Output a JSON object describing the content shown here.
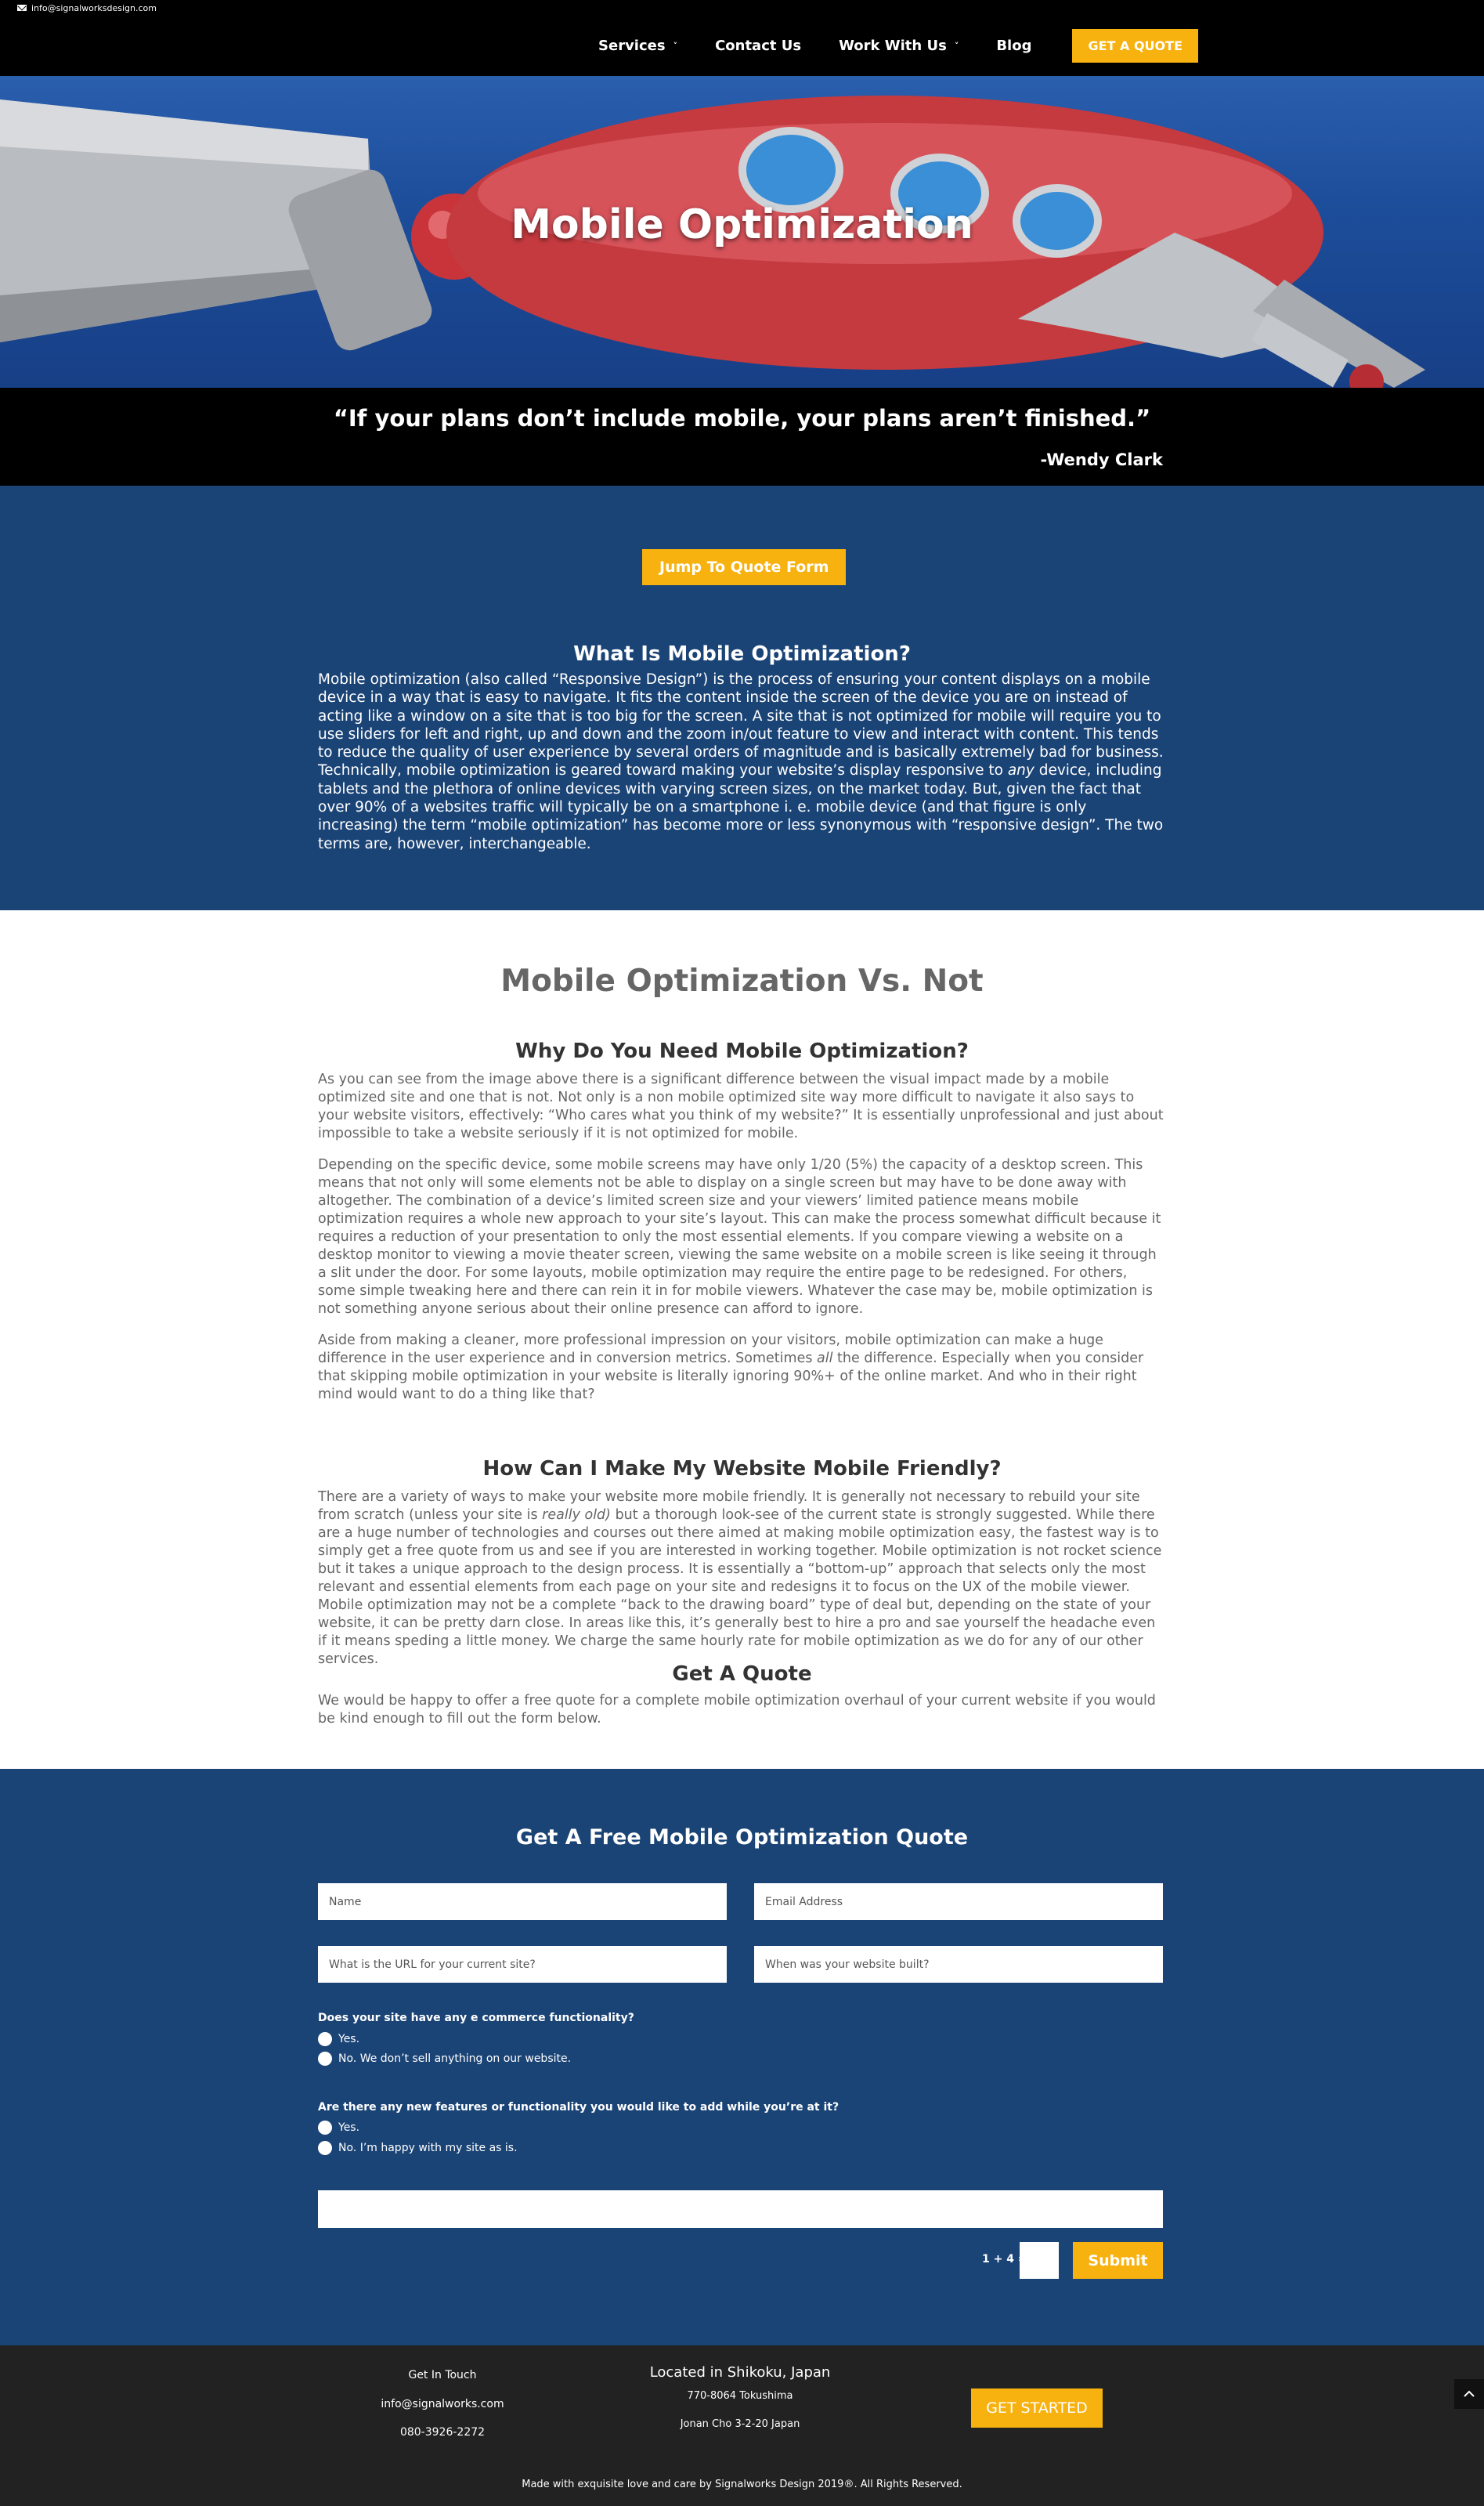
{
  "topbar": {
    "email": "info@signalworksdesign.com"
  },
  "nav": {
    "items": [
      {
        "label": "Services",
        "has_dropdown": true
      },
      {
        "label": "Contact Us",
        "has_dropdown": false
      },
      {
        "label": "Work With Us",
        "has_dropdown": true
      },
      {
        "label": "Blog",
        "has_dropdown": false
      }
    ],
    "cta": "GET A QUOTE"
  },
  "hero": {
    "title": "Mobile Optimization"
  },
  "quote": {
    "text": "“If your plans don’t include mobile, your plans aren’t finished.”",
    "author": "-Wendy Clark"
  },
  "intro": {
    "jump_button": "Jump To Quote Form",
    "title": "What Is Mobile Optimization?",
    "body_before_em": "Mobile optimization (also called “Responsive Design”)  is the process of ensuring your content displays on a  mobile device in a way that is easy to navigate. It fits the content inside the screen of the device you are on instead of acting like a window on a site that is too big for the screen. A site that is not optimized for mobile will require you to use sliders for left and right, up and down and  the zoom in/out feature to view and interact with content. This tends to reduce the quality of user experience by several orders of magnitude and is basically extremely bad for business. Technically, mobile optimization is geared  toward making your website’s display responsive to ",
    "body_em": "any",
    "body_after_em": " device, including tablets and the plethora of online devices with varying screen sizes, on the market today. But, given the fact that over 90% of a websites traffic will typically be on a smartphone i. e. mobile device (and that figure is only increasing) the term “mobile optimization” has become more or less synonymous with “responsive design”. The two terms are, however, interchangeable."
  },
  "article": {
    "title": "Mobile Optimization Vs. Not",
    "why_title": "Why Do You Need Mobile Optimization?",
    "why_p1": "As you can see from the image above there is a significant difference between the visual impact made by a mobile optimized site and one that is not. Not only is a non mobile optimized site way more difficult to navigate it also says to your website visitors, effectively: “Who cares what you think of my website?” It is essentially unprofessional and just about impossible to take a website seriously if it is not optimized for mobile.",
    "why_p2": "Depending on the specific device, some mobile screens may have only 1/20 (5%) the capacity of a desktop screen. This means that not only will some elements not be able to display on a single screen but may have to be done away with altogether. The combination of a device’s limited screen size and your viewers’ limited patience means mobile optimization requires a whole new approach to your site’s layout. This can make the process somewhat difficult because it requires a reduction of your presentation to only the most essential elements. If you compare viewing a website on a desktop monitor to viewing a movie theater screen, viewing the same website on a mobile screen is like seeing it through a slit under the door. For some layouts, mobile optimization may require the entire page to be redesigned. For others, some simple tweaking here and there can rein it in for mobile viewers. Whatever the case may be, mobile optimization is not something anyone serious about their online presence can afford to ignore.",
    "why_p3_before_em": " Aside from making a cleaner, more professional impression on your visitors, mobile optimization can make a huge difference in the user experience and in conversion metrics. Sometimes ",
    "why_p3_em": "all",
    "why_p3_after_em": " the difference. Especially when you consider that skipping mobile optimization in your website is literally ignoring 90%+ of the online market. And who in their right mind would want to do a thing like that?",
    "how_title": "How Can I Make My Website Mobile Friendly?",
    "how_p_before_em": "There are a variety of ways to make your website more mobile friendly. It is generally not necessary to rebuild your site from scratch (unless your site is ",
    "how_p_em": "really old)",
    "how_p_after_em": " but a thorough look-see of the current state is strongly suggested. While there are a huge number of technologies and courses out there aimed at making mobile optimization easy, the fastest way is to simply get a free quote from us and see if you are interested in working together.  Mobile optimization is not rocket science but it takes a unique approach to the design process. It is essentially a “bottom-up” approach that selects only the most relevant and essential elements from each page on your site and redesigns it to focus on the UX of the mobile viewer. Mobile optimization may not be a complete “back to the drawing board” type of deal but, depending on the state of your website, it can be pretty darn close. In areas like this, it’s generally best to hire a pro and sae yourself the headache even if it means speding a little money. We charge the same hourly rate for mobile optimization as we do for any of our other services.",
    "get_title": "Get A Quote",
    "get_p": "We would be happy to offer a free quote for a complete mobile optimization overhaul of your current website if you would be kind enough to fill out the form below."
  },
  "form": {
    "title": "Get A Free Mobile Optimization Quote",
    "name_placeholder": "Name",
    "email_placeholder": "Email Address",
    "url_placeholder": "What is the URL for your current site?",
    "built_placeholder": "When was your website built?",
    "q1": "Does your site have any e commerce functionality?",
    "q1_opt1": "Yes.",
    "q1_opt2": "No. We don’t sell anything on our website.",
    "q2": "Are there any new features or functionality you would like to add while you’re at it?",
    "q2_opt1": "Yes.",
    "q2_opt2": "No. I’m happy with my site as is.",
    "captcha": "1 + 4 =",
    "submit": "Submit"
  },
  "footer": {
    "contact_title": "Get In Touch",
    "contact_email": "info@signalworks.com",
    "contact_phone": "080-3926-2272",
    "location_title": "Located in Shikoku, Japan",
    "address1": "770-8064 Tokushima",
    "address2": "Jonan Cho 3-2-20 Japan",
    "cta": "GET STARTED",
    "credits": "Made with exquisite love and care by Signalworks Design 2019®. All Rights Reserved."
  },
  "colors": {
    "accent": "#f7b20f",
    "navy": "#1b4476",
    "dark": "#222222",
    "black": "#000000"
  }
}
